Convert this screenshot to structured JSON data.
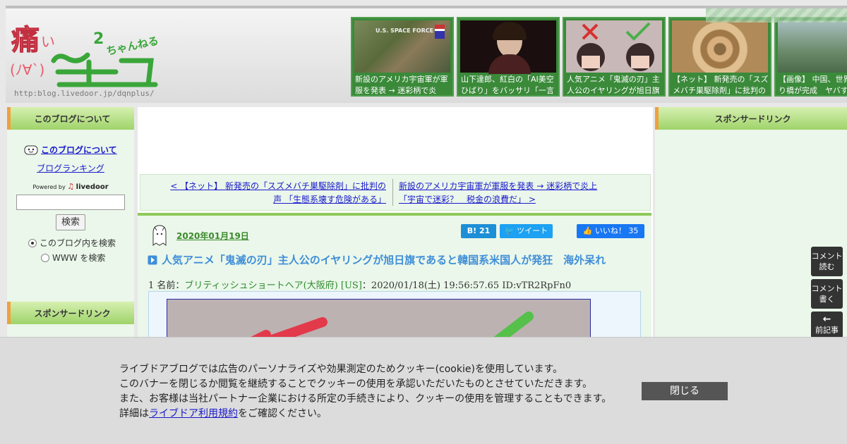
{
  "header": {
    "logo_main": "痛いニュース",
    "logo_sub": "ちゃんねる",
    "logo_face": "(ﾉ∀`)",
    "logo_url": "http:blog.livedoor.jp/dqnplus/",
    "thumbs": [
      {
        "caption": "新設のアメリカ宇宙軍が軍服を発表 → 迷彩柄で炎",
        "badge": "U.S. SPACE FORCE",
        "color": "#6b7a4a"
      },
      {
        "caption": "山下達郎、紅白の「AI美空ひばり」をバッサリ「一言",
        "color": "#2a1414"
      },
      {
        "caption": "人気アニメ「鬼滅の刃」主人公のイヤリングが旭日旗",
        "color": "#b7a6a6"
      },
      {
        "caption": "【ネット】 新発売の「スズメバチ巣駆除剤」に批判の",
        "color": "#c09a6a"
      },
      {
        "caption": "【画像】 中国、世界一の吊り橋が完成　ヤバすぎ",
        "color": "#7a9a7a"
      }
    ]
  },
  "left": {
    "heading": "このブログについて",
    "about_link": "このブログについて",
    "ranking_link": "ブログランキング",
    "powered_by": "Powered by",
    "livedoor": "livedoor",
    "search_button": "検索",
    "radio_blog": "このブログ内を検索",
    "radio_www": "WWW を検索",
    "sponsor_heading": "スポンサードリンク"
  },
  "right": {
    "sponsor_heading": "スポンサードリンク"
  },
  "nav": {
    "prev_line1": "< 【ネット】 新発売の「スズメバチ巣駆除剤」に批判の",
    "prev_line2": "声 「生態系壊す危険がある」",
    "next_line1": "新設のアメリカ宇宙軍が軍服を発表 → 迷彩柄で炎上",
    "next_line2": "「宇宙で迷彩？　税金の浪費だ」 >"
  },
  "article": {
    "date": "2020年01月19日",
    "hatena": "B! 21",
    "tweet": "ツイート",
    "like": "いいね！ 35",
    "title": "人気アニメ「鬼滅の刃」主人公のイヤリングが旭日旗であると韓国系米国人が発狂　海外呆れ",
    "post_prefix": "1 名前：",
    "post_name": "ブリティッシュショートヘア(大阪府) [US]",
    "post_meta": "：2020/01/18(土) 19:56:57.65 ID:vTR2RpFn0"
  },
  "side_buttons": {
    "read_comments": "コメント読む",
    "write_comment": "コメント書く",
    "prev_article": "前記事"
  },
  "cookie": {
    "line1": "ライブドアブログでは広告のパーソナライズや効果測定のためクッキー(cookie)を使用しています。",
    "line2": "このバナーを閉じるか閲覧を継続することでクッキーの使用を承認いただいたものとさせていただきます。",
    "line3": "また、お客様は当社パートナー企業における所定の手続きにより、クッキーの使用を管理することもできます。",
    "line4_prefix": "詳細は",
    "line4_link": "ライブドア利用規約",
    "line4_suffix": "をご確認ください。",
    "close_button": "閉じる"
  }
}
